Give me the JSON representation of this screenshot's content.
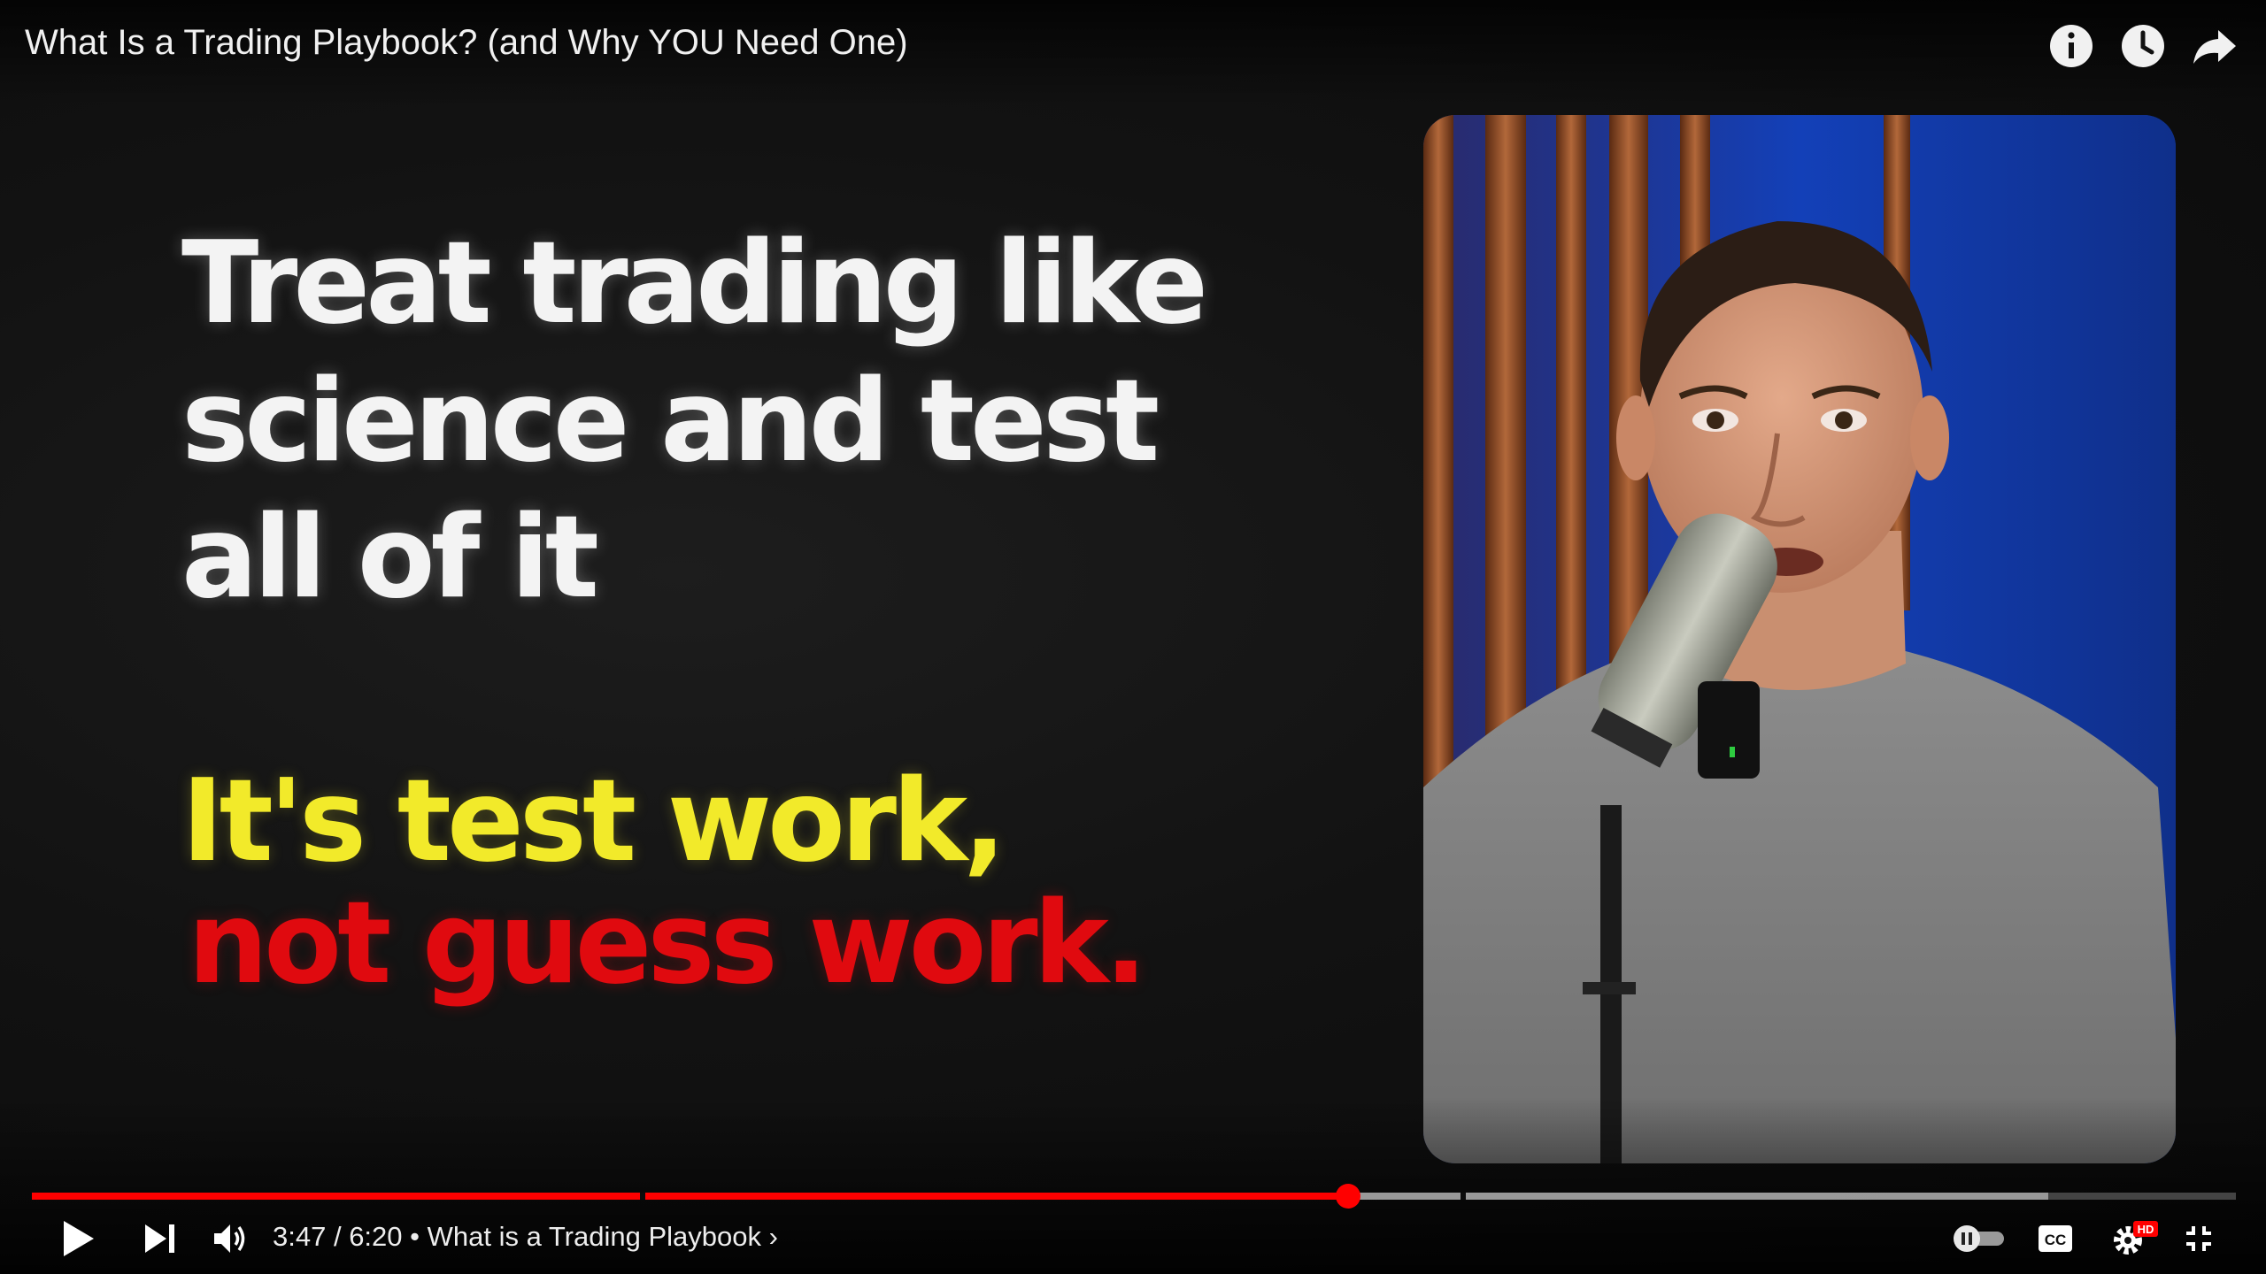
{
  "video": {
    "title": "What Is a Trading Playbook? (and Why YOU Need One)"
  },
  "slide": {
    "line1": "Treat trading like",
    "line2": "science and test",
    "line3": "all of it",
    "line4": "It's test work,",
    "line5": "not guess work."
  },
  "player": {
    "current_time": "3:47",
    "duration": "6:20",
    "time_separator": " / ",
    "chapter_separator": " • ",
    "chapter": "What is a Trading Playbook",
    "chapter_chevron": "›",
    "played_fraction": 0.597,
    "buffered_fraction": 0.915,
    "chapter_breaks": [
      0.276,
      0.648
    ],
    "hd_badge": "HD",
    "cc_label": "CC",
    "accent_color": "#ff0000",
    "slide_colors": {
      "white": "#f3f3f3",
      "yellow": "#f2ea2a",
      "red": "#e00a0f"
    }
  },
  "icons": {
    "top": [
      "info-icon",
      "watch-later-icon",
      "share-icon"
    ],
    "controls": [
      "play-icon",
      "next-icon",
      "volume-icon",
      "autoplay-toggle-icon",
      "captions-icon",
      "settings-icon",
      "exit-fullscreen-icon"
    ]
  }
}
